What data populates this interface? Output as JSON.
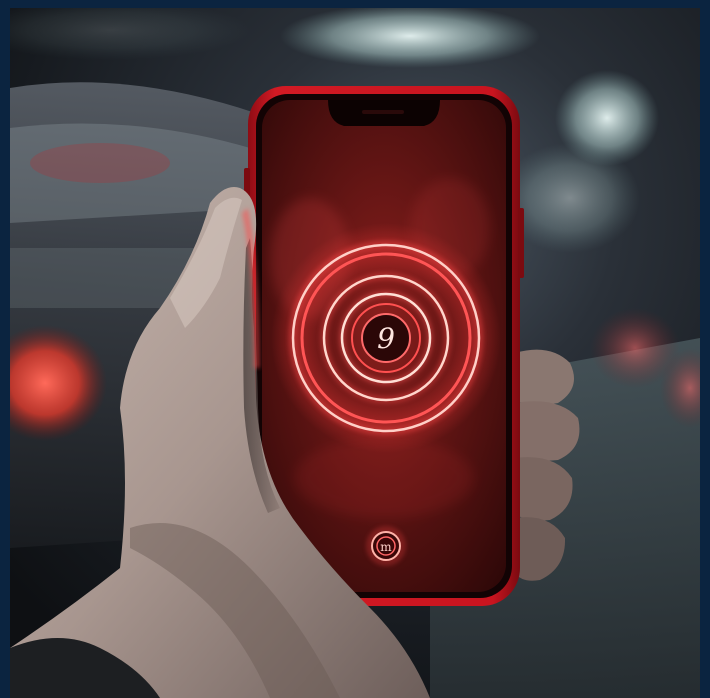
{
  "scene": {
    "description_icons": {
      "ring_glyph": "9",
      "bottom_button_glyph": "m"
    },
    "colors": {
      "frame": "#0b2440",
      "phone_body": "#b3121c",
      "screen_glow": "#ff4a4a",
      "background_dark": "#15191d"
    }
  }
}
